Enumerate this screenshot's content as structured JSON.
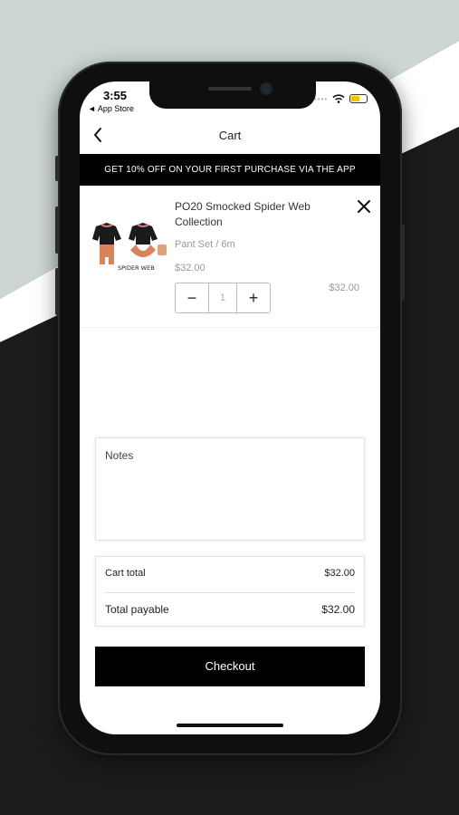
{
  "status_bar": {
    "time": "3:55",
    "back_app": "◄ App Store",
    "signal_dots": "••••"
  },
  "nav": {
    "title": "Cart"
  },
  "promo": {
    "text": "GET 10% OFF ON YOUR FIRST PURCHASE VIA THE APP"
  },
  "cart_item": {
    "name": "PO20 Smocked Spider Web Collection",
    "variant": "Pant Set / 6m",
    "unit_price": "$32.00",
    "line_total": "$32.00",
    "quantity": "1",
    "thumb_caption": "SPIDER WEB",
    "decrement": "−",
    "increment": "+"
  },
  "notes": {
    "label": "Notes"
  },
  "totals": {
    "cart_total_label": "Cart total",
    "cart_total_value": "$32.00",
    "payable_label": "Total payable",
    "payable_value": "$32.00"
  },
  "checkout": {
    "label": "Checkout"
  },
  "colors": {
    "accent": "#000000",
    "battery": "#f2c100",
    "bg_light": "#cdd6d1",
    "bg_dark": "#1c1c1c"
  }
}
